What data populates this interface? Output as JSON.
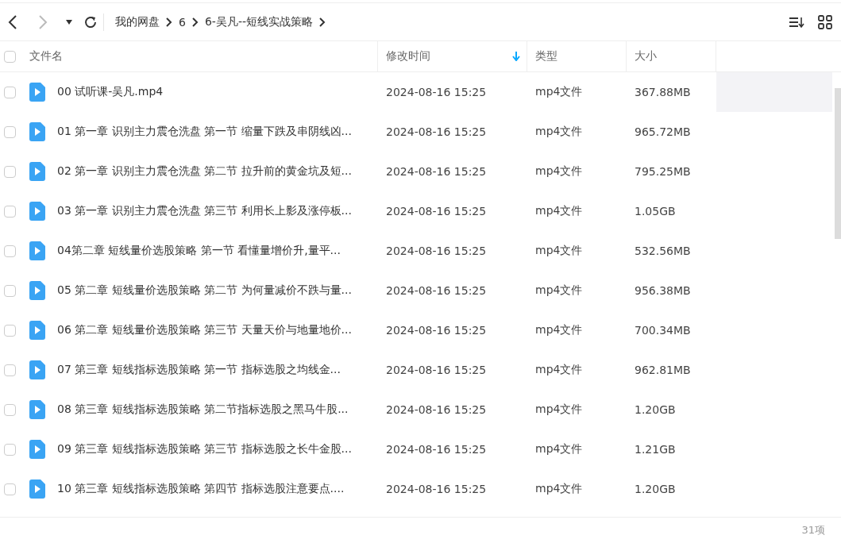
{
  "breadcrumb": [
    "我的网盘",
    "6",
    "6-吴凡--短线实战策略"
  ],
  "table": {
    "all_checked": false,
    "columns": [
      {
        "label": "文件名",
        "sorted": false
      },
      {
        "label": "修改时间",
        "sorted": true
      },
      {
        "label": "类型",
        "sorted": false
      },
      {
        "label": "大小",
        "sorted": false
      }
    ],
    "rows": [
      {
        "name": "00 试听课-吴凡.mp4",
        "modified": "2024-08-16 15:25",
        "type": "mp4文件",
        "size": "367.88MB",
        "checked": false,
        "hovered": true
      },
      {
        "name": "01 第一章 识别主力震仓洗盘 第一节 缩量下跌及串阴线凶...",
        "modified": "2024-08-16 15:25",
        "type": "mp4文件",
        "size": "965.72MB",
        "checked": false,
        "hovered": false
      },
      {
        "name": "02 第一章 识别主力震仓洗盘 第二节 拉升前的黄金坑及短...",
        "modified": "2024-08-16 15:25",
        "type": "mp4文件",
        "size": "795.25MB",
        "checked": false,
        "hovered": false
      },
      {
        "name": "03 第一章 识别主力震仓洗盘 第三节 利用长上影及涨停板...",
        "modified": "2024-08-16 15:25",
        "type": "mp4文件",
        "size": "1.05GB",
        "checked": false,
        "hovered": false
      },
      {
        "name": "04第二章 短线量价选股策略 第一节   看懂量增价升,量平...",
        "modified": "2024-08-16 15:25",
        "type": "mp4文件",
        "size": "532.56MB",
        "checked": false,
        "hovered": false
      },
      {
        "name": "05 第二章 短线量价选股策略 第二节 为何量减价不跌与量...",
        "modified": "2024-08-16 15:25",
        "type": "mp4文件",
        "size": "956.38MB",
        "checked": false,
        "hovered": false
      },
      {
        "name": "06 第二章 短线量价选股策略 第三节 天量天价与地量地价...",
        "modified": "2024-08-16 15:25",
        "type": "mp4文件",
        "size": "700.34MB",
        "checked": false,
        "hovered": false
      },
      {
        "name": "07 第三章 短线指标选股策略 第一节  指标选股之均线金...",
        "modified": "2024-08-16 15:25",
        "type": "mp4文件",
        "size": "962.81MB",
        "checked": false,
        "hovered": false
      },
      {
        "name": "08 第三章 短线指标选股策略 第二节指标选股之黑马牛股...",
        "modified": "2024-08-16 15:25",
        "type": "mp4文件",
        "size": "1.20GB",
        "checked": false,
        "hovered": false
      },
      {
        "name": "09 第三章 短线指标选股策略 第三节 指标选股之长牛金股...",
        "modified": "2024-08-16 15:25",
        "type": "mp4文件",
        "size": "1.21GB",
        "checked": false,
        "hovered": false
      },
      {
        "name": "10 第三章 短线指标选股策略 第四节 指标选股注意要点....",
        "modified": "2024-08-16 15:25",
        "type": "mp4文件",
        "size": "1.20GB",
        "checked": false,
        "hovered": false
      }
    ]
  },
  "status_bar": {
    "count": "31项"
  }
}
